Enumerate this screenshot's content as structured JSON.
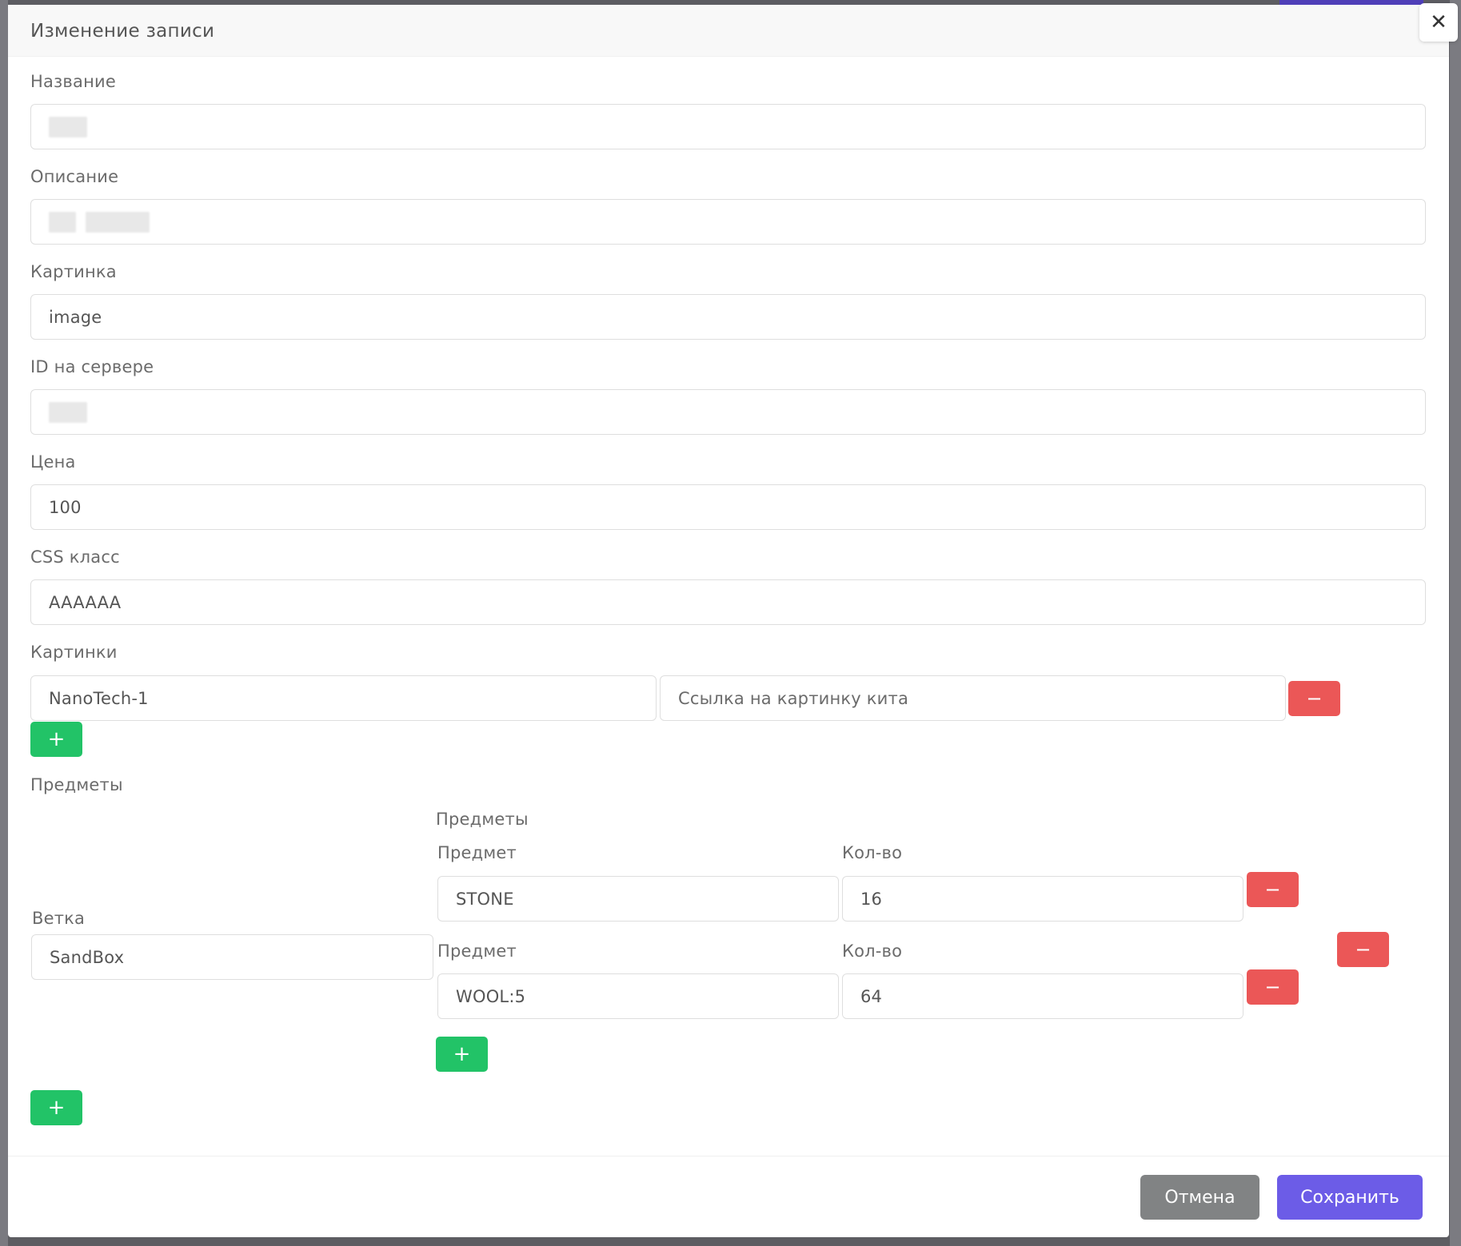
{
  "modal": {
    "title": "Изменение записи",
    "close_glyph": "✕"
  },
  "fields": {
    "name": {
      "label": "Название"
    },
    "description": {
      "label": "Описание"
    },
    "image": {
      "label": "Картинка",
      "value": "image"
    },
    "server_id": {
      "label": "ID на сервере"
    },
    "price": {
      "label": "Цена",
      "value": "100"
    },
    "css_class": {
      "label": "CSS класс",
      "value": "AAAAAA"
    }
  },
  "images": {
    "label": "Картинки",
    "rows": [
      {
        "name": "NanoTech-1",
        "link_placeholder": "Ссылка на картинку кита"
      }
    ]
  },
  "items_section": {
    "label": "Предметы",
    "branch_label": "Ветка",
    "branch_value": "SandBox",
    "inner_label": "Предметы",
    "item_label": "Предмет",
    "qty_label": "Кол-во",
    "rows": [
      {
        "item": "STONE",
        "qty": "16"
      },
      {
        "item": "WOOL:5",
        "qty": "64"
      }
    ]
  },
  "buttons": {
    "minus": "−",
    "plus": "+",
    "cancel": "Отмена",
    "save": "Сохранить"
  },
  "colors": {
    "save": "#6c5ce7",
    "cancel": "#818384",
    "danger": "#eb5757",
    "success": "#22c367"
  }
}
